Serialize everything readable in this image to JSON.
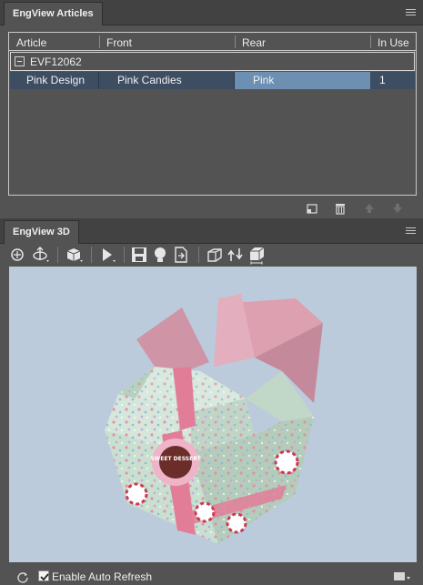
{
  "articles_panel": {
    "title": "EngView Articles",
    "columns": [
      "Article",
      "Front",
      "Rear",
      "In Use"
    ],
    "group": {
      "label": "EVF12062",
      "expander": "minus-box-icon"
    },
    "rows": [
      {
        "article": "Pink Design",
        "front": "Pink Candies",
        "rear": "Pink",
        "in_use": "1"
      }
    ],
    "toolbar": [
      "new-article-icon",
      "delete-icon",
      "move-up-icon",
      "move-down-icon"
    ]
  },
  "viewer_panel": {
    "title": "EngView 3D",
    "toolbar": [
      "zoom-icon",
      "rotate-icon",
      "view-cube-icon",
      "play-icon",
      "save-image-icon",
      "light-icon",
      "export-icon",
      "fold-icon",
      "flip-icon",
      "dimension-box-icon"
    ],
    "badge_text": "SWEET DESSERT",
    "colors": {
      "background": "#bccbdb",
      "box": "#c9dfcf",
      "lid": "#dda0b0",
      "ribbon": "#e27d98"
    }
  },
  "footer": {
    "enable_auto_refresh_label": "Enable Auto Refresh",
    "enable_auto_refresh_checked": true
  }
}
